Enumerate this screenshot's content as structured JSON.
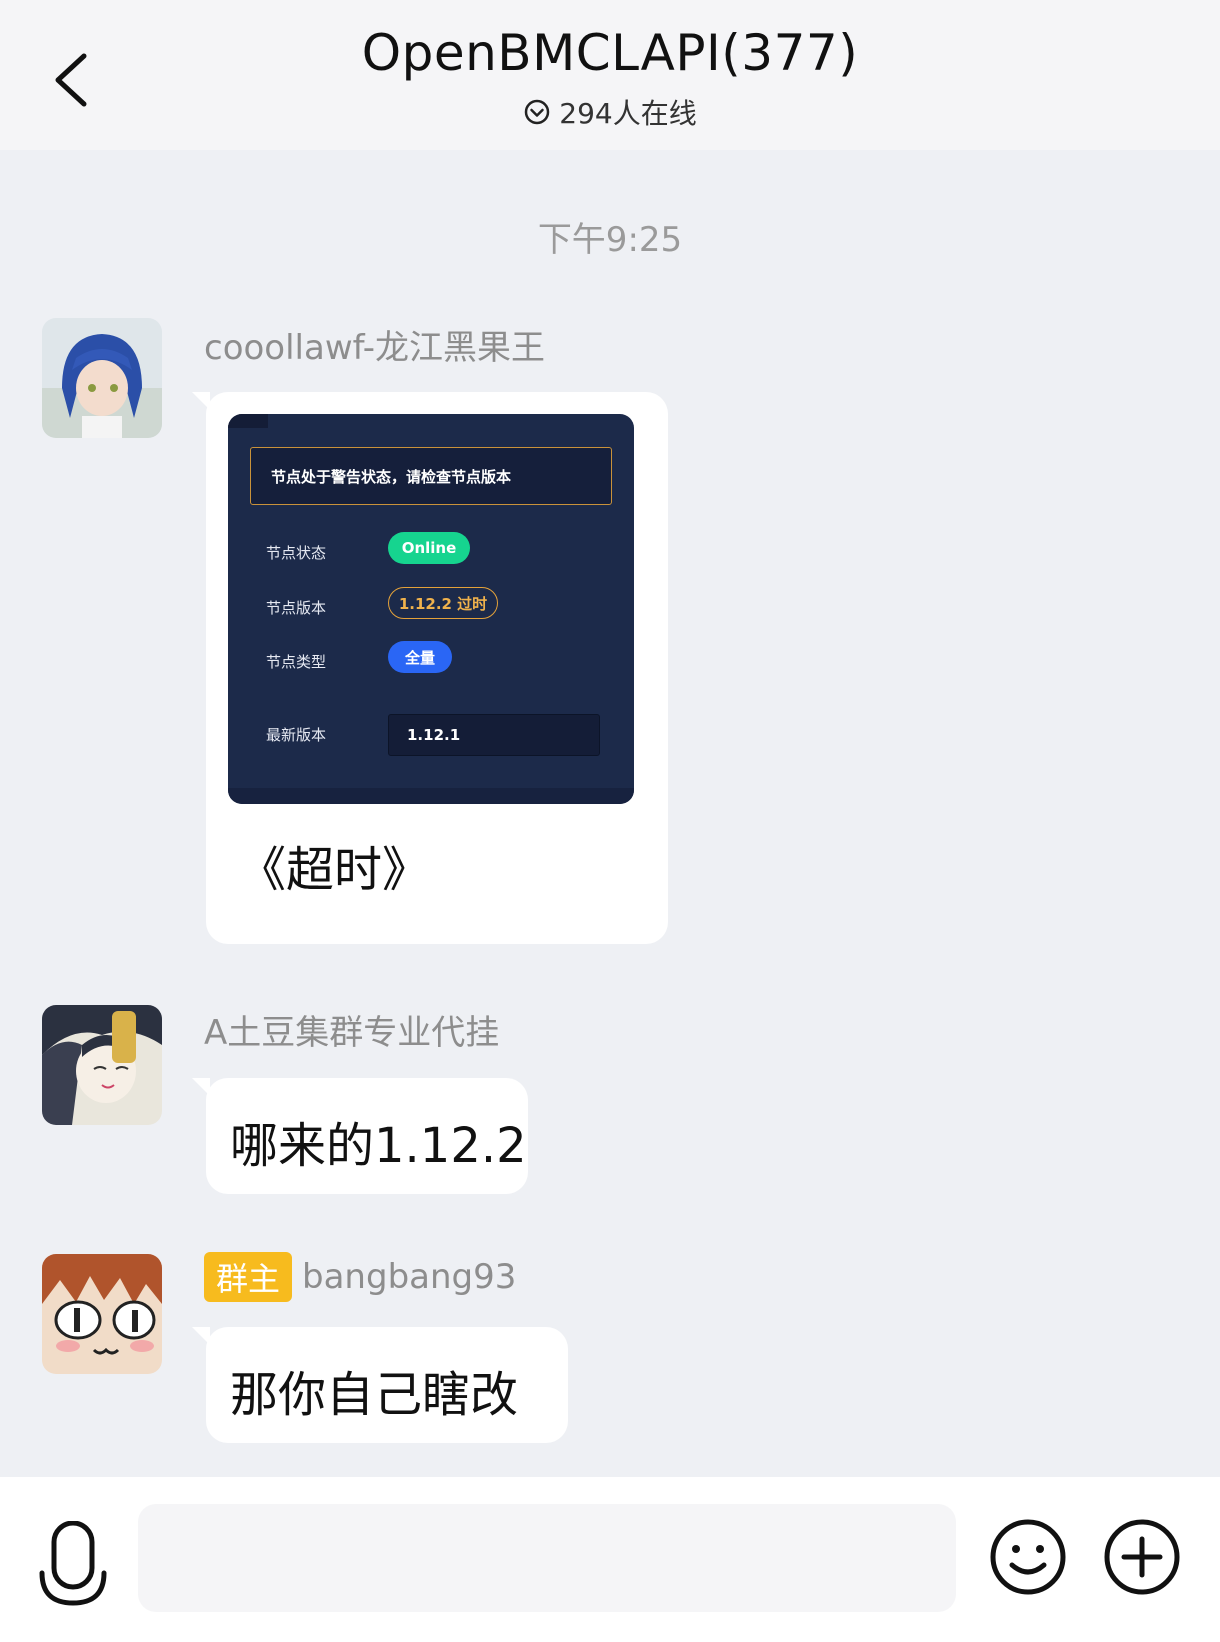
{
  "header": {
    "title": "OpenBMCLAPI(377)",
    "online_text": "294人在线",
    "back_icon": "chevron-left-icon",
    "online_icon": "circle-chevron-down-icon"
  },
  "timestamp": "下午9:25",
  "messages": [
    {
      "sender": "cooollawf-龙江黑果王",
      "image": {
        "warning": "节点处于警告状态，请检查节点版本",
        "rows": [
          {
            "label": "节点状态",
            "value": "Online"
          },
          {
            "label": "节点版本",
            "value": "1.12.2 过时"
          },
          {
            "label": "节点类型",
            "value": "全量"
          },
          {
            "label": "最新版本",
            "value": "1.12.1"
          }
        ]
      },
      "text": "《超时》"
    },
    {
      "sender": "A土豆集群专业代挂",
      "text": "哪来的1.12.2"
    },
    {
      "badge": "群主",
      "sender": "bangbang93",
      "text": "那你自己瞎改"
    }
  ],
  "input": {
    "value": "",
    "placeholder": ""
  },
  "colors": {
    "header_bg": "#f5f5f7",
    "chat_bg": "#eef0f4",
    "bubble_bg": "#ffffff",
    "owner_badge": "#f7bb1e",
    "online_green": "#16d48f",
    "full_blue": "#2a66f5",
    "warn_orange": "#e4a23a"
  }
}
